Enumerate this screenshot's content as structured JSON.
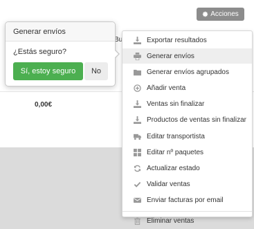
{
  "page": {
    "total_amount": "0,00€",
    "peek_text": "Bu"
  },
  "toolbar": {
    "acciones_label": "Acciones",
    "acciones_icon": "gear-icon"
  },
  "menu": {
    "items": [
      {
        "label": "Exportar resultados",
        "icon": "download-icon"
      },
      {
        "label": "Generar envíos",
        "icon": "printer-icon"
      },
      {
        "label": "Generar envíos agrupados",
        "icon": "folder-icon"
      },
      {
        "label": "Añadir venta",
        "icon": "plus-circle-icon"
      },
      {
        "label": "Ventas sin finalizar",
        "icon": "download-icon"
      },
      {
        "label": "Productos de ventas sin finalizar",
        "icon": "download-icon"
      },
      {
        "label": "Editar transportista",
        "icon": "truck-icon"
      },
      {
        "label": "Editar nº paquetes",
        "icon": "grid-icon"
      },
      {
        "label": "Actualizar estado",
        "icon": "refresh-icon"
      },
      {
        "label": "Validar ventas",
        "icon": "check-icon"
      },
      {
        "label": "Enviar facturas por email",
        "icon": "envelope-icon"
      }
    ],
    "footer_item": {
      "label": "Eliminar ventas",
      "icon": "trash-icon"
    },
    "active_index": 1
  },
  "popover": {
    "title": "Generar envíos",
    "question": "¿Estás seguro?",
    "confirm_label": "Sí, estoy seguro",
    "cancel_label": "No"
  },
  "colors": {
    "confirm_button": "#4caf50",
    "acciones_button": "#8c8c8c",
    "icon_gray": "#999999"
  }
}
